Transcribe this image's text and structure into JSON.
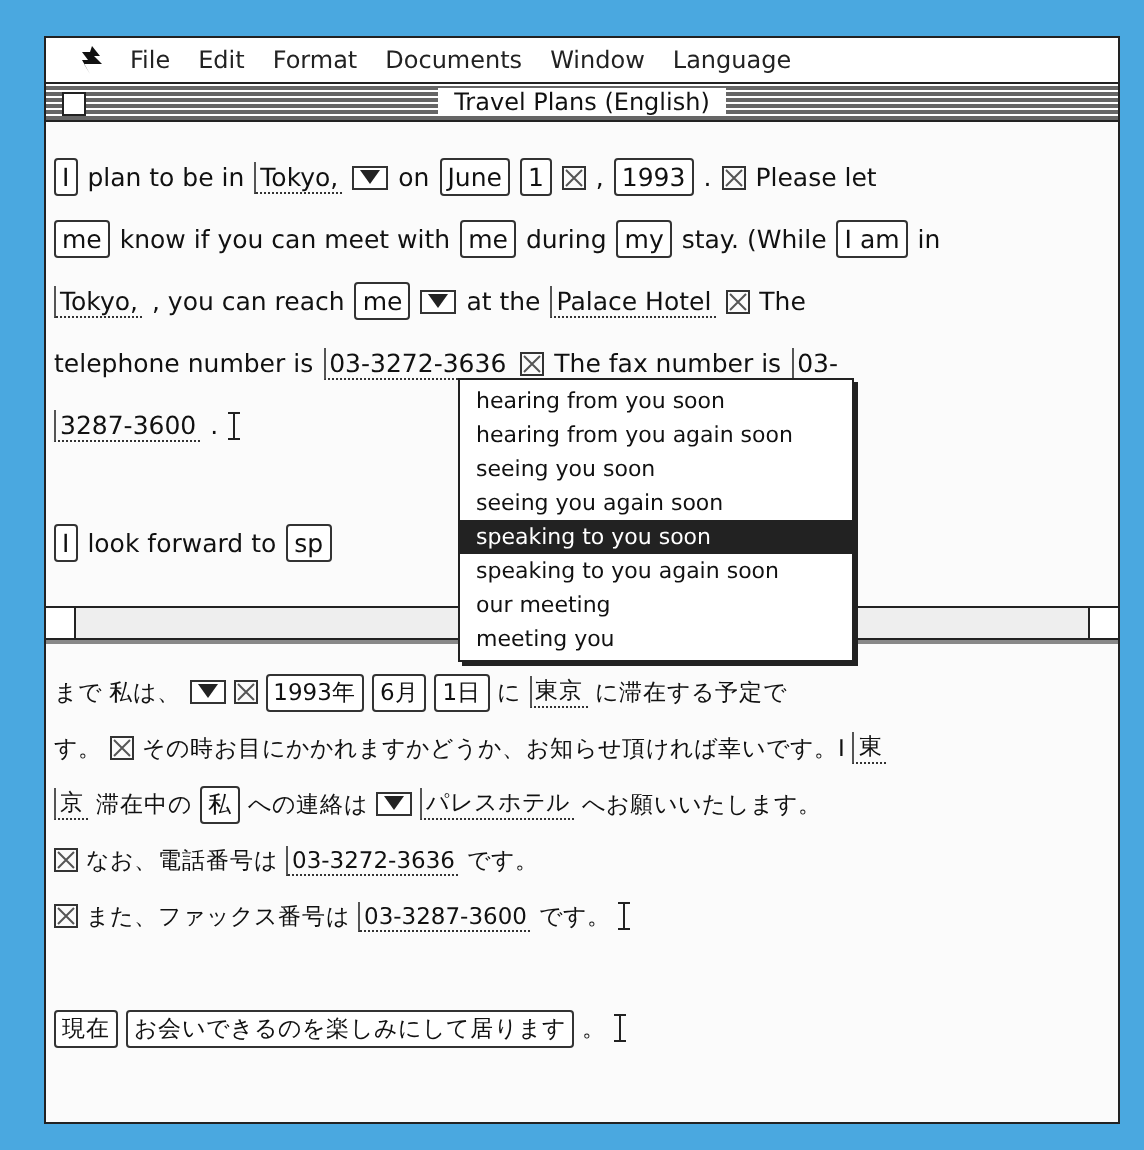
{
  "menu_bar": [
    "File",
    "Edit",
    "Format",
    "Documents",
    "Window",
    "Language"
  ],
  "window": {
    "title": "Travel Plans (English)"
  },
  "english_pane": {
    "paragraphs": [
      {
        "lines": [
          [
            {
              "kind": "box",
              "text": "I"
            },
            {
              "kind": "text",
              "text": "plan to be in"
            },
            {
              "kind": "link",
              "text": "Tokyo,"
            },
            {
              "kind": "popup"
            },
            {
              "kind": "text",
              "text": "on"
            },
            {
              "kind": "box",
              "text": "June"
            },
            {
              "kind": "box",
              "text": "1"
            },
            {
              "kind": "mark"
            },
            {
              "kind": "text",
              "text": ","
            },
            {
              "kind": "box",
              "text": "1993"
            },
            {
              "kind": "text",
              "text": "."
            },
            {
              "kind": "mark"
            },
            {
              "kind": "text",
              "text": "Please let"
            }
          ],
          [
            {
              "kind": "box",
              "text": "me"
            },
            {
              "kind": "text",
              "text": "know if you can meet with"
            },
            {
              "kind": "box",
              "text": "me"
            },
            {
              "kind": "text",
              "text": "during"
            },
            {
              "kind": "box",
              "text": "my"
            },
            {
              "kind": "text",
              "text": "stay.  (While"
            },
            {
              "kind": "box",
              "text": "I am"
            },
            {
              "kind": "text",
              "text": "in"
            }
          ],
          [
            {
              "kind": "link",
              "text": "Tokyo,"
            },
            {
              "kind": "text",
              "text": ", you can reach"
            },
            {
              "kind": "box",
              "text": "me"
            },
            {
              "kind": "popup"
            },
            {
              "kind": "text",
              "text": "at the"
            },
            {
              "kind": "link",
              "text": "Palace Hotel"
            },
            {
              "kind": "mark"
            },
            {
              "kind": "text",
              "text": "The"
            }
          ],
          [
            {
              "kind": "text",
              "text": "telephone number is"
            },
            {
              "kind": "link",
              "text": "03-3272-3636"
            },
            {
              "kind": "mark"
            },
            {
              "kind": "text",
              "text": "The fax number is"
            },
            {
              "kind": "link",
              "text": "03-"
            }
          ],
          [
            {
              "kind": "link",
              "text": "3287-3600"
            },
            {
              "kind": "text",
              "text": "."
            },
            {
              "kind": "caret"
            }
          ]
        ]
      },
      {
        "lines": [
          [
            {
              "kind": "box",
              "text": "I"
            },
            {
              "kind": "text",
              "text": "look forward to"
            },
            {
              "kind": "box",
              "text": "sp"
            }
          ]
        ]
      }
    ]
  },
  "popup_menu": {
    "items": [
      {
        "label": "hearing from you soon",
        "selected": false
      },
      {
        "label": "hearing from you again soon",
        "selected": false
      },
      {
        "label": "seeing you soon",
        "selected": false
      },
      {
        "label": "seeing you again soon",
        "selected": false
      },
      {
        "label": "speaking to you soon",
        "selected": true
      },
      {
        "label": "speaking to you again soon",
        "selected": false
      },
      {
        "label": "our meeting",
        "selected": false
      },
      {
        "label": "meeting you",
        "selected": false
      }
    ]
  },
  "japanese_pane": {
    "paragraphs": [
      {
        "lines": [
          [
            {
              "kind": "text",
              "text": "まで 私は、"
            },
            {
              "kind": "popup"
            },
            {
              "kind": "mark"
            },
            {
              "kind": "box",
              "text": "1993年"
            },
            {
              "kind": "box",
              "text": "6月"
            },
            {
              "kind": "box",
              "text": "1日"
            },
            {
              "kind": "text",
              "text": "に"
            },
            {
              "kind": "link",
              "text": "東京"
            },
            {
              "kind": "text",
              "text": "に滞在する予定で"
            }
          ],
          [
            {
              "kind": "text",
              "text": "す。"
            },
            {
              "kind": "mark"
            },
            {
              "kind": "text",
              "text": "その時お目にかかれますかどうか、お知らせ頂ければ幸いです。I"
            },
            {
              "kind": "link",
              "text": "東"
            }
          ],
          [
            {
              "kind": "link",
              "text": "京"
            },
            {
              "kind": "text",
              "text": "滞在中の"
            },
            {
              "kind": "box",
              "text": "私"
            },
            {
              "kind": "text",
              "text": "への連絡は"
            },
            {
              "kind": "popup"
            },
            {
              "kind": "link",
              "text": "パレスホテル"
            },
            {
              "kind": "text",
              "text": "へお願いいたします。"
            }
          ],
          [
            {
              "kind": "mark"
            },
            {
              "kind": "text",
              "text": "なお、電話番号は"
            },
            {
              "kind": "link",
              "text": "03-3272-3636"
            },
            {
              "kind": "text",
              "text": "です。"
            }
          ],
          [
            {
              "kind": "mark"
            },
            {
              "kind": "text",
              "text": "また、ファックス番号は"
            },
            {
              "kind": "link",
              "text": "03-3287-3600"
            },
            {
              "kind": "text",
              "text": "です。"
            },
            {
              "kind": "caret"
            }
          ]
        ]
      },
      {
        "lines": [
          [
            {
              "kind": "box",
              "text": "現在"
            },
            {
              "kind": "box",
              "text": "お会いできるのを楽しみにして居ります"
            },
            {
              "kind": "text",
              "text": "。"
            },
            {
              "kind": "caret"
            }
          ]
        ]
      }
    ]
  }
}
